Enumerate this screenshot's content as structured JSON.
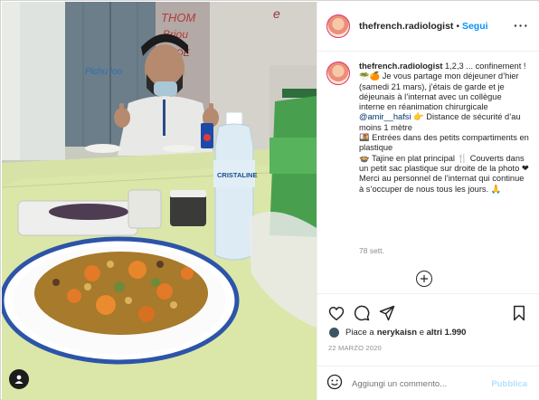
{
  "post": {
    "username": "thefrench.radiologist",
    "separator": "•",
    "follow_label": "Segui",
    "more_label": "···"
  },
  "caption": {
    "username": "thefrench.radiologist",
    "line1": " 1,2,3 ... confinement ! 🥗🍊 Je vous partage mon déjeuner d’hier (samedi 21 mars), j’étais de garde et je déjeunais à l’internat avec un collègue interne en réanimation chirurgicale ",
    "mention": "@amir__hafsi",
    "line2": " 👉 Distance de sécurité d’au moins 1 mètre",
    "line3": "🍱 Entrées dans des petits compartiments en plastique",
    "line4": "🍲 Tajine en plat principal 🍴 Couverts dans un petit sac plastique sur droite de la photo ❤ Merci au personnel de l’internat qui continue à s’occuper de nous tous les jours. 🙏",
    "time_ago": "78 sett."
  },
  "icons": {
    "like": "heart-icon",
    "comment": "comment-icon",
    "share": "share-icon",
    "save": "bookmark-icon",
    "more_comments": "plus-circle-icon",
    "emoji": "emoji-icon",
    "user_tag": "user-tag-icon"
  },
  "likes": {
    "prefix": "Piace a ",
    "user": "nerykaisn",
    "middle": " e ",
    "others": "altri 1.990"
  },
  "date": "22 MARZO 2020",
  "comment": {
    "placeholder": "Aggiungi un commento...",
    "publish_label": "Pubblica"
  },
  "colors": {
    "accent": "#0095f6",
    "publish_disabled": "#b2dffc",
    "muted": "#8e8e8e"
  }
}
